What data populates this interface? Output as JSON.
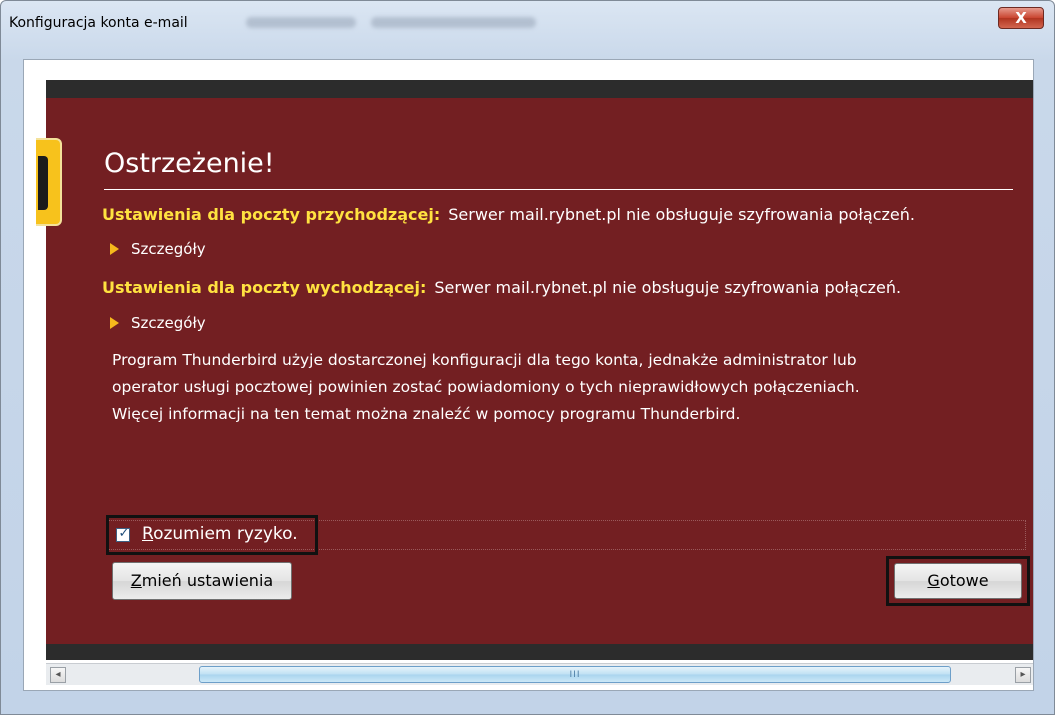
{
  "window": {
    "title": "Konfiguracja konta e-mail",
    "close_glyph": "X",
    "close_icon": "close-icon"
  },
  "warning": {
    "heading": "Ostrzeżenie!",
    "incoming_label": "Ustawienia dla poczty przychodzącej:",
    "incoming_text": "Serwer mail.rybnet.pl nie obsługuje szyfrowania połączeń.",
    "details_label_1": "Szczegóły",
    "outgoing_label": "Ustawienia dla poczty wychodzącej:",
    "outgoing_text": "Serwer mail.rybnet.pl nie obsługuje szyfrowania połączeń.",
    "details_label_2": "Szczegóły",
    "paragraph_lines": [
      "Program Thunderbird użyje dostarczonej konfiguracji dla tego konta, jednakże administrator lub",
      "operator usługi pocztowej powinien zostać powiadomiony o tych nieprawidłowych połączeniach.",
      "Więcej informacji na ten temat można znaleźć w pomocy programu Thunderbird."
    ],
    "accept_risk": {
      "checked": true,
      "label_first": "R",
      "label_rest": "ozumiem ryzyko."
    }
  },
  "buttons": {
    "change_first": "Z",
    "change_rest": "mień ustawienia",
    "done_first": "G",
    "done_rest": "otowe"
  },
  "scrollbar": {
    "left_glyph": "◂",
    "right_glyph": "▸",
    "grip": "III"
  },
  "colors": {
    "panel": "#731f22",
    "label_yellow": "#ffe240",
    "accent_orange": "#f6b81c"
  }
}
